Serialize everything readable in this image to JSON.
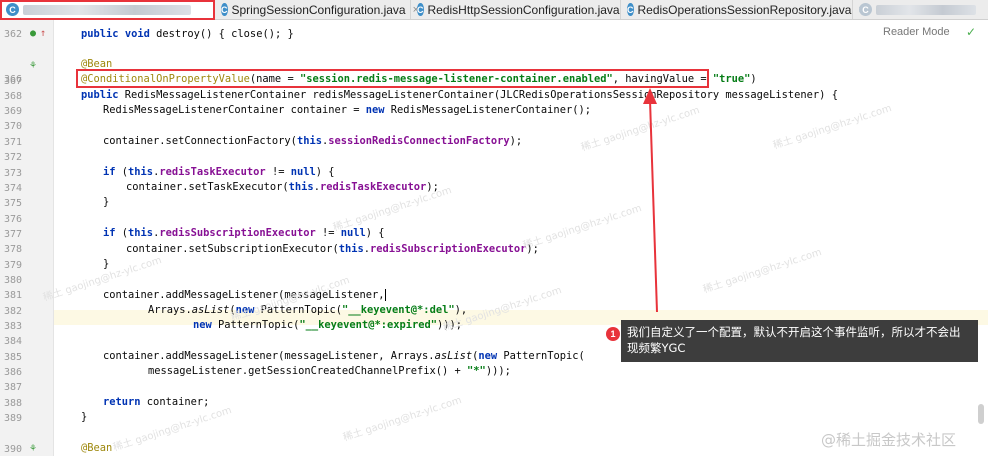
{
  "tabs": [
    {
      "label": "",
      "icon": "java-class-icon",
      "blurred": true
    },
    {
      "label": "SpringSessionConfiguration.java",
      "icon": "java-class-icon"
    },
    {
      "label": "RedisHttpSessionConfiguration.java",
      "icon": "java-class-icon"
    },
    {
      "label": "RedisOperationsSessionRepository.java",
      "icon": "java-class-icon"
    }
  ],
  "editor": {
    "reader_mode": "Reader Mode",
    "line_numbers": [
      "362",
      "366",
      "367",
      "368",
      "369",
      "370",
      "371",
      "372",
      "373",
      "374",
      "375",
      "376",
      "377",
      "378",
      "379",
      "380",
      "381",
      "382",
      "383",
      "384",
      "385",
      "386",
      "387",
      "388",
      "389",
      "390"
    ],
    "code": {
      "l362_a": "public",
      "l362_b": " ",
      "l362_c": "void",
      "l362_d": " destroy() { close(); }",
      "l366": "@Bean",
      "l367_a": "@ConditionalOnPropertyValue",
      "l367_b": "(name = ",
      "l367_c": "\"session.redis-message-listener-container.enabled\"",
      "l367_d": ", havingValue = ",
      "l367_e": "\"true\"",
      "l367_f": ")",
      "l368_a": "public",
      "l368_b": " RedisMessageListenerContainer redisMessageListenerContainer(JLCRedisOperationsSessionRepository messageListener) {",
      "l369_a": "RedisMessageListenerContainer container = ",
      "l369_b": "new",
      "l369_c": " RedisMessageListenerContainer();",
      "l371_a": "container.setConnectionFactory(",
      "l371_b": "this",
      "l371_c": ".",
      "l371_d": "sessionRedisConnectionFactory",
      "l371_e": ");",
      "l373_a": "if",
      "l373_b": " (",
      "l373_c": "this",
      "l373_d": ".",
      "l373_e": "redisTaskExecutor",
      "l373_f": " != ",
      "l373_g": "null",
      "l373_h": ") {",
      "l374_a": "container.setTaskExecutor(",
      "l374_b": "this",
      "l374_c": ".",
      "l374_d": "redisTaskExecutor",
      "l374_e": ");",
      "l375": "}",
      "l377_a": "if",
      "l377_b": " (",
      "l377_c": "this",
      "l377_d": ".",
      "l377_e": "redisSubscriptionExecutor",
      "l377_f": " != ",
      "l377_g": "null",
      "l377_h": ") {",
      "l378_a": "container.setSubscriptionExecutor(",
      "l378_b": "this",
      "l378_c": ".",
      "l378_d": "redisSubscriptionExecutor",
      "l378_e": ");",
      "l379": "}",
      "l381": "container.addMessageListener(messageListener,",
      "l382_a": "Arrays.",
      "l382_b": "asList",
      "l382_c": "(",
      "l382_d": "new",
      "l382_e": " PatternTopic(",
      "l382_f": "\"__keyevent@*:del\"",
      "l382_g": "),",
      "l383_a": "new",
      "l383_b": " PatternTopic(",
      "l383_c": "\"__keyevent@*:expired\"",
      "l383_d": ")));",
      "l385_a": "container.addMessageListener(messageListener, Arrays.",
      "l385_b": "asList",
      "l385_c": "(",
      "l385_d": "new",
      "l385_e": " PatternTopic(",
      "l386_a": "messageListener.getSessionCreatedChannelPrefix() + ",
      "l386_b": "\"*\"",
      "l386_c": ")));",
      "l388_a": "return",
      "l388_b": " container;",
      "l389": "}",
      "l390": "@Bean"
    }
  },
  "annotation": {
    "badge": "1",
    "text": "我们自定义了一个配置，默认不开启这个事件监听，所以才不会出现频繁YGC"
  },
  "watermarks": [
    "稀土 gaojing@hz-ylc.com",
    "稀土 gaojing@hz-ylc.com",
    "稀土 gaojing@hz-ylc.com",
    "稀土 gaojing@hz-ylc.com",
    "稀土 gaojing@hz-ylc.com",
    "稀土 gaojing@hz-ylc.com",
    "稀土 gaojing@hz-ylc.com",
    "稀土 gaojing@hz-ylc.com",
    "稀土 gaojing@hz-ylc.com",
    "稀土 gaojing@hz-ylc.com"
  ],
  "brand": "@稀土掘金技术社区",
  "colors": {
    "highlight": "#e8333b",
    "keyword": "#0033b3",
    "string": "#067d17",
    "field": "#871094",
    "annotation": "#9e880d"
  }
}
